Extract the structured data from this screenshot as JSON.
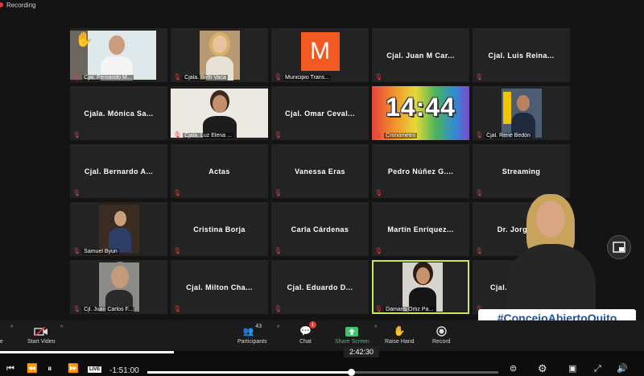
{
  "recording": {
    "label": "Recording"
  },
  "grid": {
    "tiles": [
      {
        "name": "Cjal. Fernando M...",
        "display": "video",
        "hand_raised": true
      },
      {
        "name": "Cjala. Brith Vaca",
        "display": "video"
      },
      {
        "name": "Municipio Trans...",
        "display": "logo",
        "logo_letter": "M"
      },
      {
        "name": "",
        "display": "name",
        "big_name": "Cjal. Juan M Car..."
      },
      {
        "name": "",
        "display": "name",
        "big_name": "Cjal. Luis Reina..."
      },
      {
        "name": "",
        "display": "name",
        "big_name": "Cjala. Mónica Sa..."
      },
      {
        "name": "Cjala. Luz Elena ...",
        "display": "video"
      },
      {
        "name": "",
        "display": "name",
        "big_name": "Cjal. Omar Ceval..."
      },
      {
        "name": "Cronómetro",
        "display": "clock",
        "clock": "14:44"
      },
      {
        "name": "Cjal. René Bedón",
        "display": "video"
      },
      {
        "name": "",
        "display": "name",
        "big_name": "Cjal. Bernardo A..."
      },
      {
        "name": "",
        "display": "name",
        "big_name": "Actas"
      },
      {
        "name": "",
        "display": "name",
        "big_name": "Vanessa Eras"
      },
      {
        "name": "",
        "display": "name",
        "big_name": "Pedro Núñez G...."
      },
      {
        "name": "",
        "display": "name",
        "big_name": "Streaming"
      },
      {
        "name": "Samuel Byun",
        "display": "video"
      },
      {
        "name": "",
        "display": "name",
        "big_name": "Cristina Borja"
      },
      {
        "name": "",
        "display": "name",
        "big_name": "Carla Cárdenas"
      },
      {
        "name": "",
        "display": "name",
        "big_name": "Martín Enríquez..."
      },
      {
        "name": "",
        "display": "name",
        "big_name": "Dr. Jorge Y..."
      },
      {
        "name": "Cjl. Juan Carlos F...",
        "display": "video"
      },
      {
        "name": "",
        "display": "name",
        "big_name": "Cjal. Milton Cha..."
      },
      {
        "name": "",
        "display": "name",
        "big_name": "Cjal. Eduardo D..."
      },
      {
        "name": "Damaris Ortiz Pa...",
        "display": "video",
        "active": true
      },
      {
        "name": "",
        "display": "name",
        "big_name": "Cjal."
      }
    ]
  },
  "overlay": {
    "hashtag": "#ConcejoAbiertoQuito",
    "live_badge": "Le"
  },
  "toolbar": {
    "mute_label": "ute",
    "start_video_label": "Start Video",
    "participants_label": "Participants",
    "participants_count": "43",
    "chat_label": "Chat",
    "chat_badge": "1",
    "share_label": "Share Screen",
    "raise_hand_label": "Raise Hand",
    "record_label": "Record"
  },
  "player": {
    "time_tooltip": "2:42:30",
    "live_label": "LIVE",
    "remaining": "-1:51:00",
    "progress": 0.58,
    "top_progress": 0.27
  },
  "colors": {
    "accent_active": "#c6e85b",
    "share_green": "#3ec46d",
    "mic_off_red": "#e23b3b",
    "hashtag_blue": "#1e4fa3",
    "logo_orange": "#f25a22"
  }
}
